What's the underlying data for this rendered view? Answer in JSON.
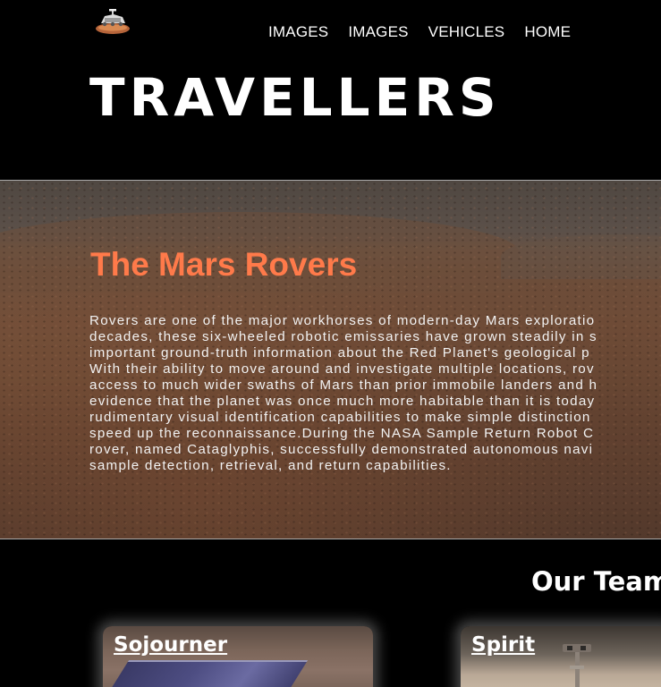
{
  "header": {
    "nav": [
      "IMAGES",
      "IMAGES",
      "VEHICLES",
      "HOME"
    ],
    "site_title": "TRAVELLERS",
    "logo_icon": "rover-logo-icon"
  },
  "hero": {
    "title": "The Mars Rovers",
    "title_color": "#ff7a4a",
    "lines": [
      "Rovers are one of the major workhorses of modern-day Mars exploratio",
      "decades, these six-wheeled robotic emissaries have grown steadily in s",
      "important ground-truth information about the Red Planet's geological p",
      "With their ability to move around and investigate multiple locations, rov",
      "access to much wider swaths of Mars than prior immobile landers and h",
      "evidence that the planet was once much more habitable than it is today",
      "rudimentary visual identification capabilities to make simple distinction",
      "speed up the reconnaissance.During the NASA Sample Return Robot C",
      "rover, named Cataglyphis, successfully demonstrated autonomous navi",
      "sample detection, retrieval, and return capabilities."
    ]
  },
  "team": {
    "title": "Our Team",
    "cards": [
      {
        "label": "Sojourner"
      },
      {
        "label": "Spirit"
      }
    ]
  },
  "colors": {
    "background": "#000000",
    "text": "#ffffff",
    "accent": "#ff7a4a"
  }
}
